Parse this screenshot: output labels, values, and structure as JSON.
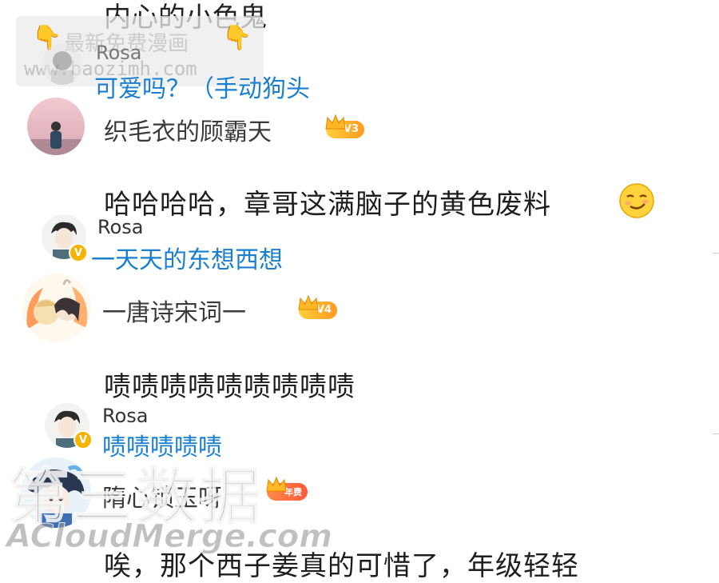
{
  "top_cut": {
    "text": "内心的小色鬼"
  },
  "watermark_top": {
    "label": "最新免费漫画",
    "url": "www.baozimh.com"
  },
  "reply_top": {
    "name": "Rosa",
    "text": "可爱吗？（手动狗头"
  },
  "comments": [
    {
      "username": "织毛衣的顾霸天",
      "badge": "V3",
      "text": "哈哈哈哈，章哥这满脑子的黄色废料",
      "emoji": "smirk-emoji",
      "reply": {
        "name": "Rosa",
        "text": "一天天的东想西想"
      }
    },
    {
      "username": "一唐诗宋词一",
      "badge": "V4",
      "text": "啧啧啧啧啧啧啧啧啧",
      "reply": {
        "name": "Rosa",
        "text": "啧啧啧啧啧"
      }
    },
    {
      "username": "隋心锁玉呀",
      "badge": "年费",
      "text": "唉，那个西子姜真的可惜了，年级轻轻"
    }
  ],
  "v_mark": "V",
  "watermark_bottom": {
    "cn": "第三数据",
    "en": "ACloudMerge.com"
  },
  "colors": {
    "reply_blue": "#1a7fd0",
    "vip_gold": "#ffb627"
  }
}
